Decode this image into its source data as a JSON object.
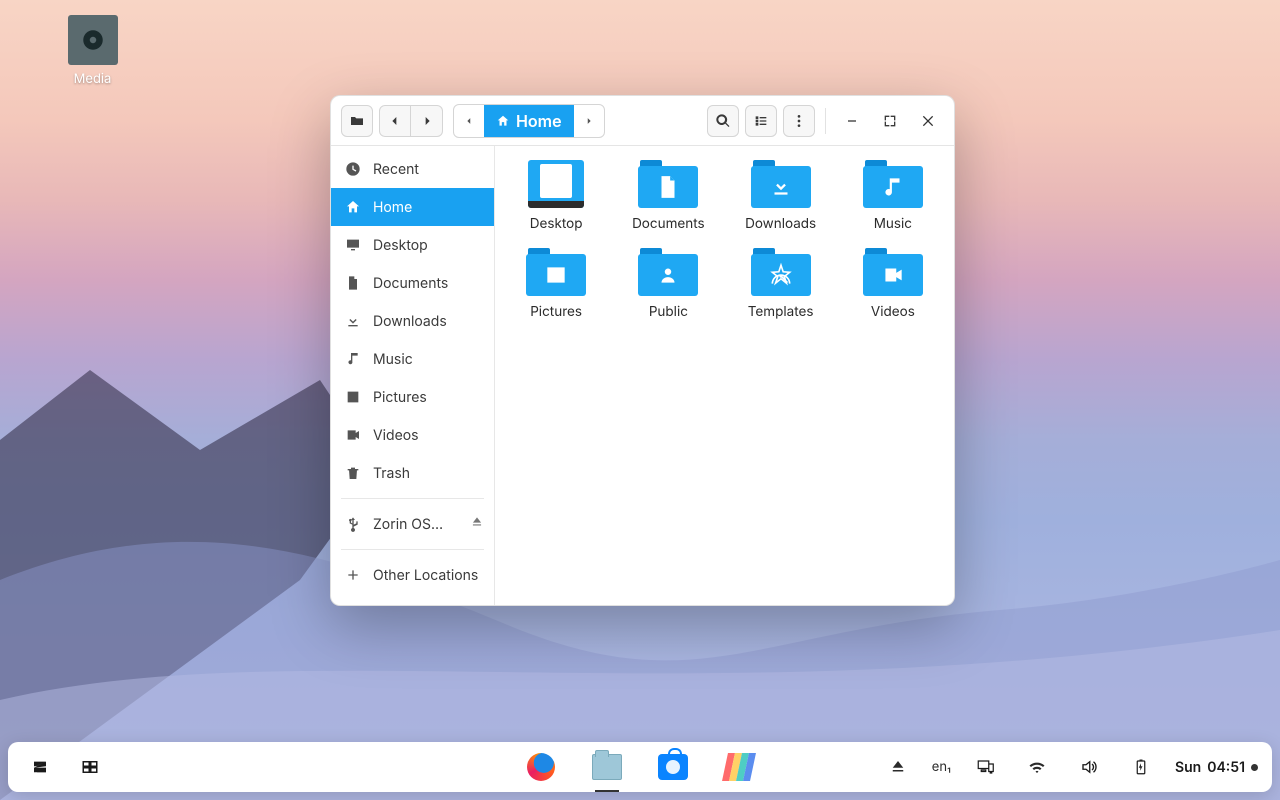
{
  "desktop": {
    "items": [
      {
        "label": "Media"
      }
    ]
  },
  "window": {
    "path": {
      "current": "Home"
    },
    "sidebar": {
      "items": [
        {
          "icon": "clock",
          "label": "Recent"
        },
        {
          "icon": "home",
          "label": "Home",
          "active": true
        },
        {
          "icon": "desktop",
          "label": "Desktop"
        },
        {
          "icon": "document",
          "label": "Documents"
        },
        {
          "icon": "download",
          "label": "Downloads"
        },
        {
          "icon": "music",
          "label": "Music"
        },
        {
          "icon": "pictures",
          "label": "Pictures"
        },
        {
          "icon": "videos",
          "label": "Videos"
        },
        {
          "icon": "trash",
          "label": "Trash"
        }
      ],
      "devices": [
        {
          "icon": "usb",
          "label": "Zorin OS…",
          "ejectable": true
        }
      ],
      "other": {
        "label": "Other Locations"
      }
    },
    "folders": [
      {
        "name": "Desktop",
        "icon": "desktop"
      },
      {
        "name": "Documents",
        "icon": "document"
      },
      {
        "name": "Downloads",
        "icon": "download"
      },
      {
        "name": "Music",
        "icon": "music"
      },
      {
        "name": "Pictures",
        "icon": "pictures"
      },
      {
        "name": "Public",
        "icon": "public"
      },
      {
        "name": "Templates",
        "icon": "templates"
      },
      {
        "name": "Videos",
        "icon": "videos"
      }
    ]
  },
  "taskbar": {
    "lang": "en₁",
    "day": "Sun",
    "time": "04:51"
  }
}
